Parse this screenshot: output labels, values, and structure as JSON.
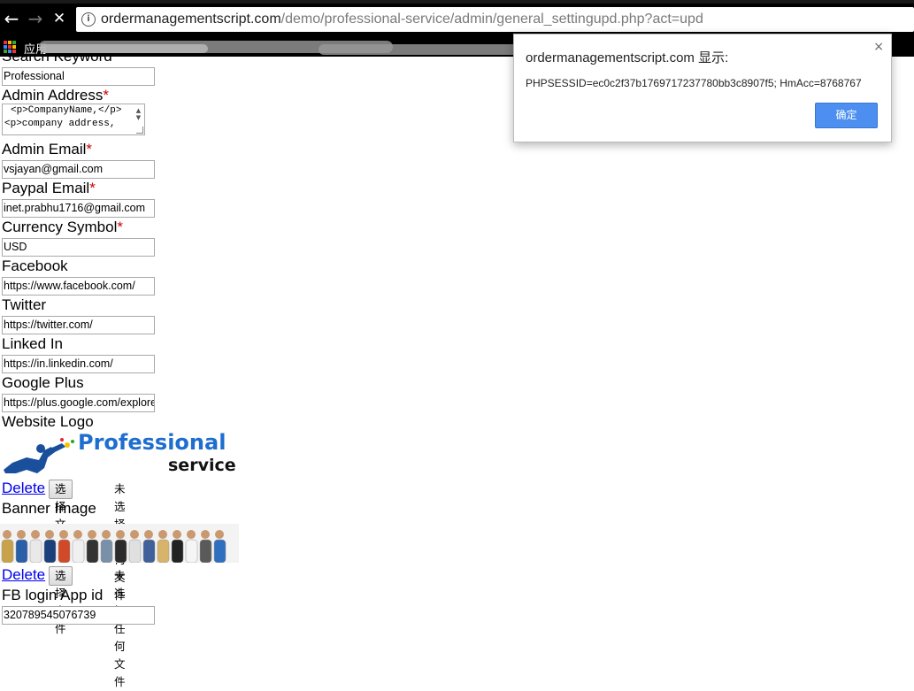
{
  "browser": {
    "back_icon": "←",
    "forward_icon": "→",
    "stop_icon": "✕",
    "info_icon": "i",
    "url_host": "ordermanagementscript.com",
    "url_path": "/demo/professional-service/admin/general_settingupd.php?act=upd",
    "apps_label": "应用"
  },
  "form": {
    "search_keyword_label": "Search Keyword",
    "search_keyword_value": "Professional",
    "admin_address_label": "Admin Address",
    "admin_address_lines": [
      "<p>CompanyName,</p>",
      "<p>company address,"
    ],
    "admin_email_label": "Admin Email",
    "admin_email_value": "vsjayan@gmail.com",
    "paypal_email_label": "Paypal Email",
    "paypal_email_value": "inet.prabhu1716@gmail.com",
    "currency_label": "Currency Symbol",
    "currency_value": "USD",
    "facebook_label": "Facebook",
    "facebook_value": "https://www.facebook.com/",
    "twitter_label": "Twitter",
    "twitter_value": "https://twitter.com/",
    "linkedin_label": "Linked In",
    "linkedin_value": "https://in.linkedin.com/",
    "googleplus_label": "Google Plus",
    "googleplus_value": "https://plus.google.com/explore",
    "logo_label": "Website Logo",
    "logo_text_top": "Professional",
    "logo_text_bottom": "service",
    "banner_label": "Banner Image",
    "delete_label": "Delete",
    "choose_file_label": "选择文件",
    "no_file_label": "未选择任何文件",
    "fb_app_id_label": "FB login App id",
    "fb_app_id_value": "320789545076739",
    "required_mark": "*"
  },
  "dialog": {
    "title": "ordermanagementscript.com 显示:",
    "message": "PHPSESSID=ec0c2f37b1769717237780bb3c8907f5; HmAcc=8768767",
    "ok_label": "确定",
    "close_icon": "×"
  },
  "colors": {
    "link": "#0000ee",
    "required": "#cc0000",
    "dialog_button": "#4c8ff0"
  }
}
